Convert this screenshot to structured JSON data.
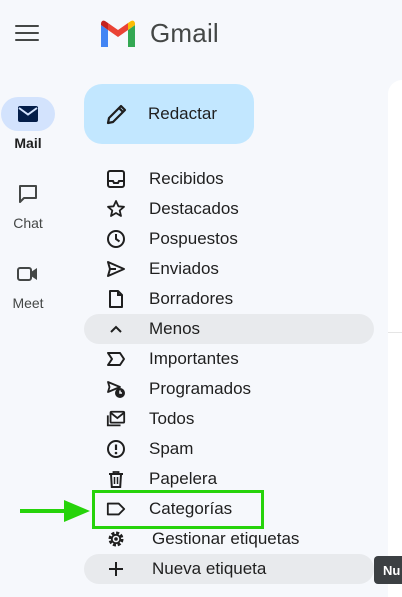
{
  "rail": {
    "items": [
      {
        "label": "Mail"
      },
      {
        "label": "Chat"
      },
      {
        "label": "Meet"
      }
    ]
  },
  "brand": {
    "name": "Gmail"
  },
  "compose": {
    "label": "Redactar"
  },
  "nav": {
    "items": [
      {
        "label": "Recibidos",
        "icon": "inbox-icon"
      },
      {
        "label": "Destacados",
        "icon": "star-icon"
      },
      {
        "label": "Pospuestos",
        "icon": "clock-icon"
      },
      {
        "label": "Enviados",
        "icon": "send-icon"
      },
      {
        "label": "Borradores",
        "icon": "draft-icon"
      },
      {
        "label": "Menos",
        "icon": "chevron-up-icon"
      },
      {
        "label": "Importantes",
        "icon": "important-icon"
      },
      {
        "label": "Programados",
        "icon": "scheduled-send-icon"
      },
      {
        "label": "Todos",
        "icon": "all-mail-icon"
      },
      {
        "label": "Spam",
        "icon": "spam-icon"
      },
      {
        "label": "Papelera",
        "icon": "trash-icon"
      },
      {
        "label": "Categorías",
        "icon": "label-icon"
      },
      {
        "label": "Gestionar etiquetas",
        "icon": "gear-icon"
      },
      {
        "label": "Nueva etiqueta",
        "icon": "plus-icon"
      }
    ]
  },
  "tooltip": {
    "text": "Nu"
  },
  "colors": {
    "compose_bg": "#c2e7ff",
    "rail_active_bg": "#d3e3fd",
    "highlight_box": "#26d30a",
    "hover_row": "#e8eaed"
  }
}
